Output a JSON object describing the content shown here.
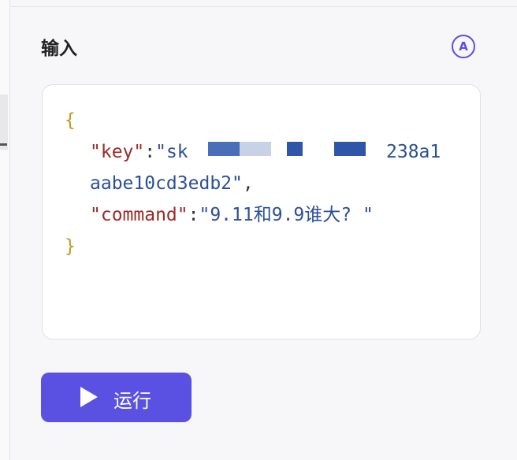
{
  "section": {
    "title": "输入",
    "auto_icon": "A"
  },
  "code": {
    "open_brace": "{",
    "key_name": "\"key\"",
    "colon": ":",
    "key_value_start": "\"sk",
    "key_value_tail": "238a1",
    "key_value_line2": "aabe10cd3edb2\"",
    "comma": ",",
    "command_name": "\"command\"",
    "command_value": "\"9.11和9.9谁大? \"",
    "close_brace": "}"
  },
  "run_button": {
    "label": "运行",
    "icon": "play-icon"
  },
  "colors": {
    "accent": "#5a51e3",
    "brace": "#c49a1c",
    "key": "#9a2a24",
    "string": "#2b4f97"
  }
}
